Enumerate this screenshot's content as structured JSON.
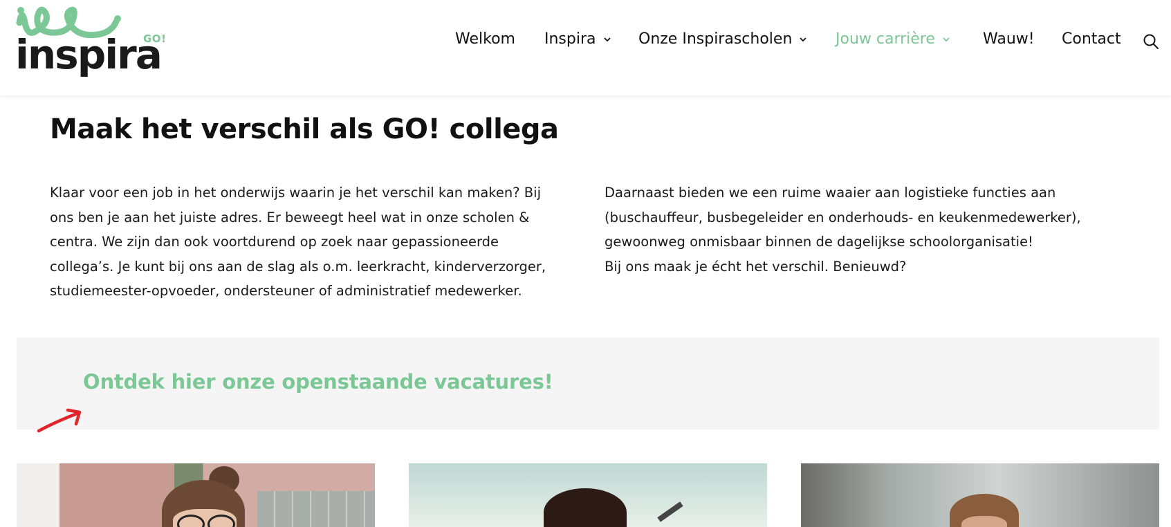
{
  "brand": {
    "name": "inspira",
    "badge": "GO!",
    "accent_color": "#7bc796",
    "text_color": "#111111"
  },
  "nav": {
    "items": [
      {
        "label": "Welkom",
        "has_dropdown": false,
        "active": false
      },
      {
        "label": "Inspira",
        "has_dropdown": true,
        "active": false
      },
      {
        "label": "Onze Inspirascholen",
        "has_dropdown": true,
        "active": false
      },
      {
        "label": "Jouw carrière",
        "has_dropdown": true,
        "active": true
      },
      {
        "label": "Wauw!",
        "has_dropdown": false,
        "active": false
      },
      {
        "label": "Contact",
        "has_dropdown": false,
        "active": false
      }
    ],
    "search_icon": "search-icon"
  },
  "main": {
    "title": "Maak het verschil als GO! collega",
    "left_paragraph": "Klaar voor een job in het onderwijs waarin je het verschil kan maken? Bij ons ben je aan het juiste adres. Er beweegt heel wat in onze scholen & centra. We zijn dan ook voortdurend op zoek naar gepassioneerde collega’s. Je kunt bij ons aan de slag als o.m. leerkracht, kinderverzorger, studiemeester-opvoeder, ondersteuner of administratief medewerker.",
    "right_paragraph_1": "Daarnaast bieden we een ruime waaier aan logistieke functies aan (buschauffeur, busbegeleider en onderhouds- en keukenmedewerker), gewoonweg onmisbaar binnen de dagelijkse schoolorganisatie!",
    "right_paragraph_2": "Bij ons maak je écht het verschil. Benieuwd?"
  },
  "vacatures": {
    "link_label": "Ontdek hier onze openstaande vacatures!",
    "arrow_icon": "arrow-icon",
    "arrow_color": "#e0262b",
    "band_color": "#f5f5f5"
  },
  "photos": [
    {
      "name": "photo-card-1"
    },
    {
      "name": "photo-card-2"
    },
    {
      "name": "photo-card-3"
    }
  ]
}
